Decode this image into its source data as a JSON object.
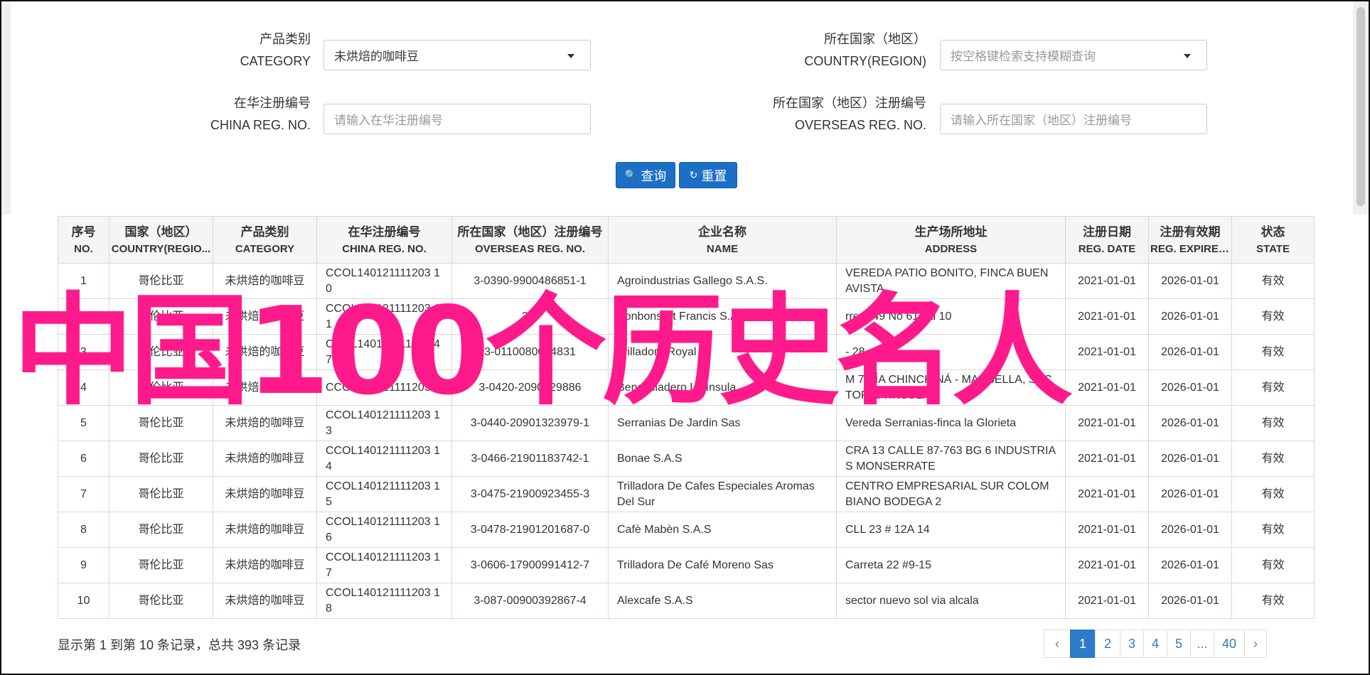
{
  "search": {
    "category": {
      "label_cn": "产品类别",
      "label_en": "CATEGORY",
      "value": "未烘焙的咖啡豆"
    },
    "country": {
      "label_cn": "所在国家（地区）",
      "label_en": "COUNTRY(REGION)",
      "placeholder": "按空格键检索支持模糊查询"
    },
    "china_reg": {
      "label_cn": "在华注册编号",
      "label_en": "CHINA REG. NO.",
      "placeholder": "请输入在华注册编号"
    },
    "overseas_reg": {
      "label_cn": "所在国家（地区）注册编号",
      "label_en": "OVERSEAS REG. NO.",
      "placeholder": "请输入所在国家（地区）注册编号"
    },
    "query_label": "查询",
    "reset_label": "重置"
  },
  "table": {
    "headers": [
      {
        "cn": "序号",
        "en": "NO."
      },
      {
        "cn": "国家（地区）",
        "en": "COUNTRY(REGIO..."
      },
      {
        "cn": "产品类别",
        "en": "CATEGORY"
      },
      {
        "cn": "在华注册编号",
        "en": "CHINA REG. NO."
      },
      {
        "cn": "所在国家（地区）注册编号",
        "en": "OVERSEAS REG. NO."
      },
      {
        "cn": "企业名称",
        "en": "NAME"
      },
      {
        "cn": "生产场所地址",
        "en": "ADDRESS"
      },
      {
        "cn": "注册日期",
        "en": "REG. DATE"
      },
      {
        "cn": "注册有效期",
        "en": "REG. EXPIRE ..."
      },
      {
        "cn": "状态",
        "en": "STATE"
      }
    ],
    "rows": [
      [
        "1",
        "哥伦比亚",
        "未烘焙的咖啡豆",
        "CCOL140121111203 10",
        "3-0390-9900486851-1",
        "Agroindustrias Gallego S.A.S.",
        "VEREDA PATIO BONITO, FINCA BUEN AVISTA",
        "2021-01-01",
        "2026-01-01",
        "有效"
      ],
      [
        "2",
        "哥伦比亚",
        "未烘焙的咖啡豆",
        "CCOL140121111203 11",
        "3-0",
        "Bonbons St Francis S.A.S.",
        "rrera 49 No 61 Su 10",
        "2021-01-01",
        "2026-01-01",
        "有效"
      ],
      [
        "3",
        "哥伦比亚",
        "未烘焙的咖啡豆",
        "CCOL140121111202 47",
        "3-0110080014831",
        "Trilladora Royal",
        "- 28",
        "2021-01-01",
        "2026-01-01",
        "有效"
      ],
      [
        "4",
        "哥伦比亚",
        "未烘焙的咖啡豆",
        "CCOL140121111203",
        "3-0420-2090029886",
        "Beneficiadero La Insula",
        "M 7 VÍA CHINCHINÁ - MARSELLA, SECTOR LA INSULA",
        "2021-01-01",
        "2026-01-01",
        "有效"
      ],
      [
        "5",
        "哥伦比亚",
        "未烘焙的咖啡豆",
        "CCOL140121111203 13",
        "3-0440-20901323979-1",
        "Serranias De Jardin Sas",
        "Vereda Serranias-finca la Glorieta",
        "2021-01-01",
        "2026-01-01",
        "有效"
      ],
      [
        "6",
        "哥伦比亚",
        "未烘焙的咖啡豆",
        "CCOL140121111203 14",
        "3-0466-21901183742-1",
        "Bonae S.A.S",
        "CRA 13 CALLE 87-763 BG 6 INDUSTRIAS MONSERRATE",
        "2021-01-01",
        "2026-01-01",
        "有效"
      ],
      [
        "7",
        "哥伦比亚",
        "未烘焙的咖啡豆",
        "CCOL140121111203 15",
        "3-0475-21900923455-3",
        "Trilladora De Cafes Especiales Aromas Del Sur",
        "CENTRO EMPRESARIAL SUR COLOMBIANO BODEGA 2",
        "2021-01-01",
        "2026-01-01",
        "有效"
      ],
      [
        "8",
        "哥伦比亚",
        "未烘焙的咖啡豆",
        "CCOL140121111203 16",
        "3-0478-21901201687-0",
        "Cafè Mabèn S.A.S",
        "CLL 23 # 12A 14",
        "2021-01-01",
        "2026-01-01",
        "有效"
      ],
      [
        "9",
        "哥伦比亚",
        "未烘焙的咖啡豆",
        "CCOL140121111203 17",
        "3-0606-17900991412-7",
        "Trilladora De Café Moreno Sas",
        "Carreta 22 #9-15",
        "2021-01-01",
        "2026-01-01",
        "有效"
      ],
      [
        "10",
        "哥伦比亚",
        "未烘焙的咖啡豆",
        "CCOL140121111203 18",
        "3-087-00900392867-4",
        "Alexcafe S.A.S",
        "sector nuevo sol via alcala",
        "2021-01-01",
        "2026-01-01",
        "有效"
      ]
    ]
  },
  "footer": {
    "summary": "显示第 1 到第 10 条记录，总共 393 条记录",
    "pages": [
      "‹",
      "1",
      "2",
      "3",
      "4",
      "5",
      "...",
      "40",
      "›"
    ],
    "active_page": "1"
  },
  "overlay": {
    "text": "中国100个历史名人",
    "color": "#ff1a8c"
  },
  "colors": {
    "accent": "#1b6fc7",
    "page_active": "#2d7ac8",
    "link": "#337ab7"
  }
}
